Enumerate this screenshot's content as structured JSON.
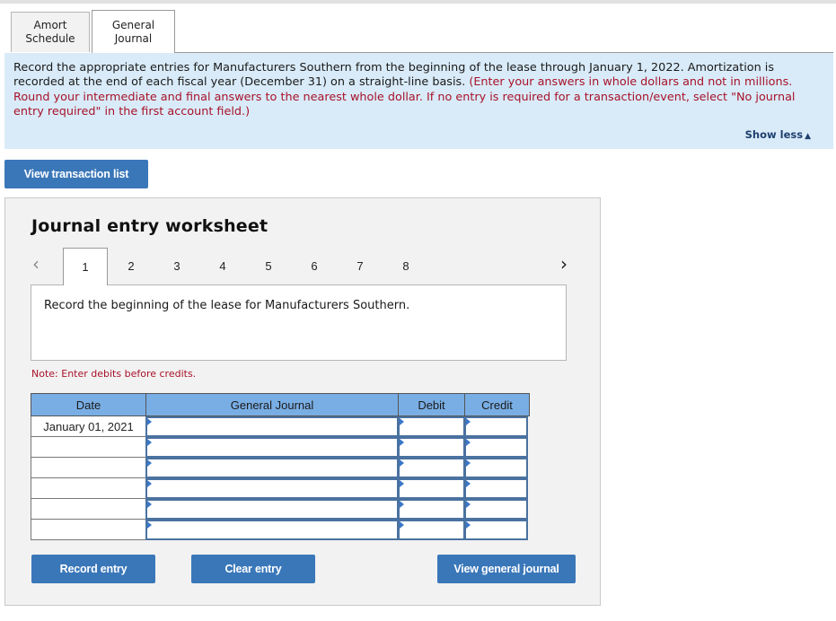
{
  "tabs": [
    {
      "label": "Amort\nSchedule",
      "line1": "Amort",
      "line2": "Schedule",
      "active": false
    },
    {
      "label": "General\nJournal",
      "line1": "General",
      "line2": "Journal",
      "active": true
    }
  ],
  "instructions": {
    "text_black": "Record the appropriate entries for Manufacturers Southern from the beginning of the lease through January 1, 2022. Amortization is recorded at the end of each fiscal year (December 31) on a straight-line basis.",
    "text_red": "(Enter your answers in whole dollars and not in millions. Round your intermediate and final answers to the nearest whole dollar. If no entry is required for a transaction/event, select \"No journal entry required\" in the first account field.)",
    "show_less_label": "Show less",
    "show_less_icon": "triangle-up-icon"
  },
  "buttons": {
    "view_transaction_list": "View transaction list",
    "record_entry": "Record entry",
    "clear_entry": "Clear entry",
    "view_general_journal": "View general journal"
  },
  "worksheet": {
    "title": "Journal entry worksheet",
    "prev_icon": "‹",
    "next_icon": "›",
    "steps": [
      "1",
      "2",
      "3",
      "4",
      "5",
      "6",
      "7",
      "8"
    ],
    "active_step": "1",
    "description": "Record the beginning of the lease for Manufacturers Southern.",
    "note": "Note: Enter debits before credits.",
    "columns": {
      "date": "Date",
      "general_journal": "General Journal",
      "debit": "Debit",
      "credit": "Credit"
    },
    "rows": [
      {
        "date": "January 01, 2021",
        "account": "",
        "debit": "",
        "credit": ""
      },
      {
        "date": "",
        "account": "",
        "debit": "",
        "credit": ""
      },
      {
        "date": "",
        "account": "",
        "debit": "",
        "credit": ""
      },
      {
        "date": "",
        "account": "",
        "debit": "",
        "credit": ""
      },
      {
        "date": "",
        "account": "",
        "debit": "",
        "credit": ""
      },
      {
        "date": "",
        "account": "",
        "debit": "",
        "credit": ""
      }
    ]
  },
  "colors": {
    "button_blue": "#3a77b9",
    "instruction_bg": "#d9ebf8",
    "header_blue": "#79aee4",
    "note_red": "#a8122a"
  }
}
